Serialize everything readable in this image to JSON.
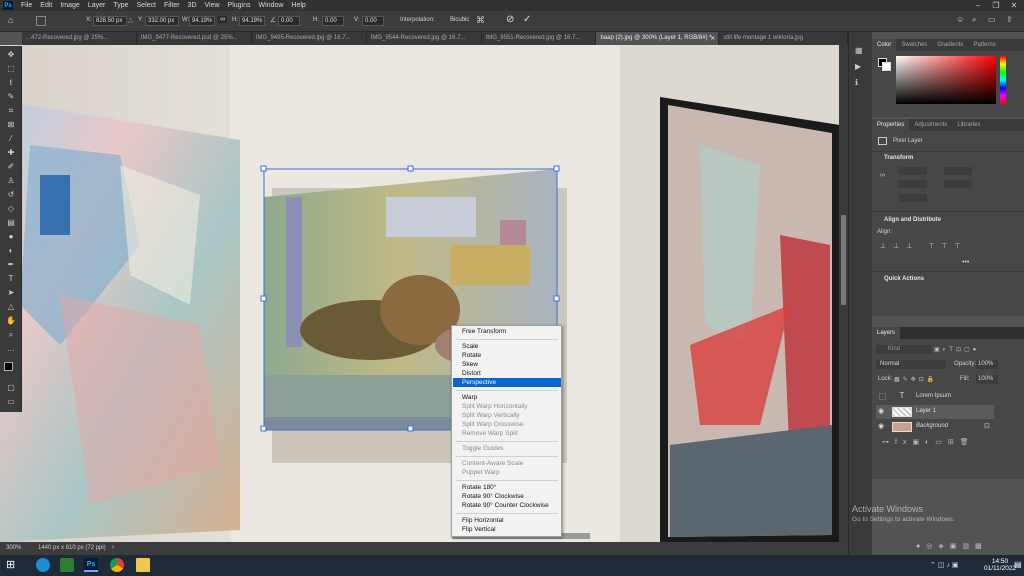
{
  "menubar": {
    "items": [
      "File",
      "Edit",
      "Image",
      "Layer",
      "Type",
      "Select",
      "Filter",
      "3D",
      "View",
      "Plugins",
      "Window",
      "Help"
    ]
  },
  "options": {
    "x_label": "X:",
    "x_value": "828.50 px",
    "y_label": "Y:",
    "y_value": "332.00 px",
    "w_label": "W:",
    "w_value": "94.19%",
    "h_label": "H:",
    "h_value": "94.19%",
    "angle_value": "0.00",
    "hskew_label": "H:",
    "hskew_value": "0.00",
    "vskew_label": "V:",
    "vskew_value": "0.00",
    "interp_label": "Interpolation:",
    "interp_value": "Bicubic"
  },
  "tabs": [
    {
      "label": "...472-Recovered.jpg @ 25%...",
      "active": false
    },
    {
      "label": "IMG_9477-Recovered.psd @ 25%...",
      "active": false
    },
    {
      "label": "IMG_9495-Recovered.jpg @ 16.7...",
      "active": false
    },
    {
      "label": "IMG_9544-Recovered.jpg @ 16.7...",
      "active": false
    },
    {
      "label": "IMG_9551-Recovered.jpg @ 16.7...",
      "active": false
    },
    {
      "label": "baap (2).jpg @ 300% (Layer 1, RGB/8#) *",
      "active": true
    },
    {
      "label": "still life montage 1 wiktoria.jpg",
      "active": false
    }
  ],
  "context_menu": {
    "free_transform": "Free Transform",
    "scale": "Scale",
    "rotate": "Rotate",
    "skew": "Skew",
    "distort": "Distort",
    "perspective": "Perspective",
    "warp": "Warp",
    "split_h": "Split Warp Horizontally",
    "split_v": "Split Warp Vertically",
    "split_c": "Split Warp Crosswise",
    "remove_split": "Remove Warp Split",
    "toggle_guides": "Toggle Guides",
    "content_aware": "Content-Aware Scale",
    "puppet": "Puppet Warp",
    "rot180": "Rotate 180°",
    "rot90cw": "Rotate 90° Clockwise",
    "rot90ccw": "Rotate 90° Counter Clockwise",
    "flip_h": "Flip Horizontal",
    "flip_v": "Flip Vertical"
  },
  "status": {
    "zoom": "300%",
    "doc_size": "1440 px x 810 px (72 ppi)"
  },
  "color_panel": {
    "tabs": [
      "Color",
      "Swatches",
      "Gradients",
      "Patterns"
    ]
  },
  "properties_panel": {
    "tabs": [
      "Properties",
      "Adjustments",
      "Libraries"
    ],
    "layer_kind": "Pixel Layer",
    "transform_title": "Transform",
    "align_title": "Align and Distribute",
    "align_label": "Align:",
    "quick_actions_title": "Quick Actions"
  },
  "layers_panel": {
    "tab": "Layers",
    "kind_placeholder": "Kind",
    "blend_mode": "Normal",
    "opacity_label": "Opacity:",
    "opacity_value": "100%",
    "lock_label": "Lock:",
    "fill_label": "Fill:",
    "fill_value": "100%",
    "layers": [
      {
        "name": "Lorem Ipsum",
        "visible": false,
        "type": "text"
      },
      {
        "name": "Layer 1",
        "visible": true,
        "type": "pixel",
        "selected": true
      },
      {
        "name": "Background",
        "visible": true,
        "type": "background",
        "locked": true
      }
    ]
  },
  "watermark": {
    "title": "Activate Windows",
    "subtitle": "Go to Settings to activate Windows."
  },
  "taskbar": {
    "time": "14:50",
    "date": "01/11/2022"
  },
  "colors": {
    "accent_blue": "#0a64d2",
    "ps_blue": "#31a8ff",
    "panel_bg": "#474747",
    "chrome_dark": "#323232"
  }
}
